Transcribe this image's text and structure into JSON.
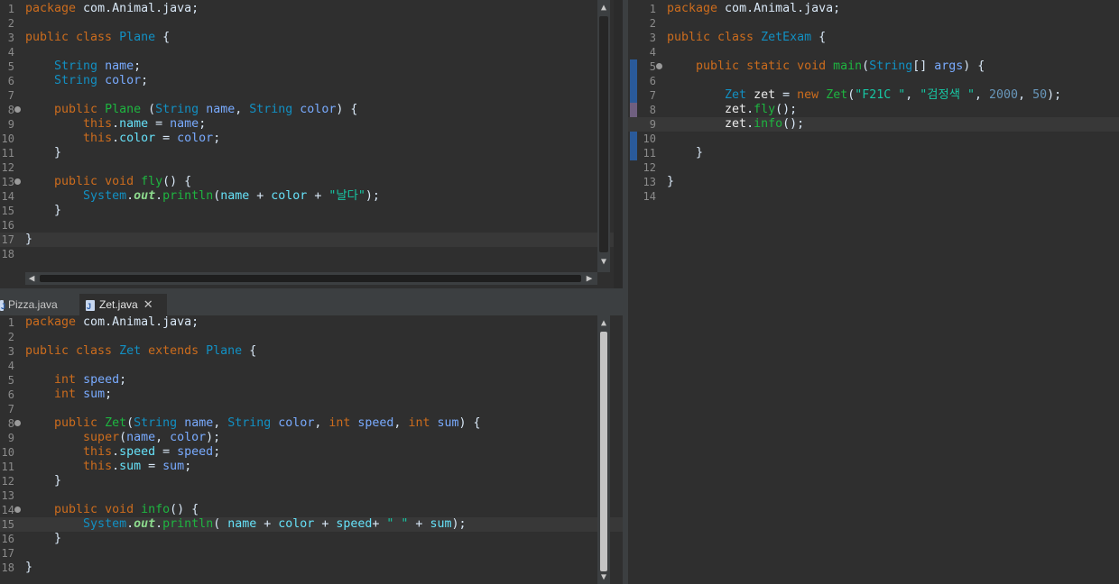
{
  "editors": {
    "plane": {
      "current_line": 17,
      "lines": [
        {
          "n": "1",
          "tokens": [
            [
              "kw",
              "package"
            ],
            [
              "plain",
              " com.Animal.java;"
            ]
          ]
        },
        {
          "n": "2",
          "tokens": []
        },
        {
          "n": "3",
          "tokens": [
            [
              "kw",
              "public class "
            ],
            [
              "type",
              "Plane "
            ],
            [
              "plain",
              "{"
            ]
          ]
        },
        {
          "n": "4",
          "tokens": []
        },
        {
          "n": "5",
          "tokens": [
            [
              "plain",
              "    "
            ],
            [
              "type",
              "String"
            ],
            [
              "plain",
              " "
            ],
            [
              "var",
              "name"
            ],
            [
              "plain",
              ";"
            ]
          ]
        },
        {
          "n": "6",
          "tokens": [
            [
              "plain",
              "    "
            ],
            [
              "type",
              "String"
            ],
            [
              "plain",
              " "
            ],
            [
              "var",
              "color"
            ],
            [
              "plain",
              ";"
            ]
          ]
        },
        {
          "n": "7",
          "tokens": []
        },
        {
          "n": "8",
          "fold": true,
          "tokens": [
            [
              "plain",
              "    "
            ],
            [
              "kw",
              "public "
            ],
            [
              "fn",
              "Plane"
            ],
            [
              "plain",
              " ("
            ],
            [
              "type",
              "String"
            ],
            [
              "plain",
              " "
            ],
            [
              "var",
              "name"
            ],
            [
              "plain",
              ", "
            ],
            [
              "type",
              "String"
            ],
            [
              "plain",
              " "
            ],
            [
              "var",
              "color"
            ],
            [
              "plain",
              ") {"
            ]
          ]
        },
        {
          "n": "9",
          "tokens": [
            [
              "plain",
              "        "
            ],
            [
              "kw",
              "this"
            ],
            [
              "plain",
              "."
            ],
            [
              "field",
              "name"
            ],
            [
              "plain",
              " = "
            ],
            [
              "var",
              "name"
            ],
            [
              "plain",
              ";"
            ]
          ]
        },
        {
          "n": "10",
          "tokens": [
            [
              "plain",
              "        "
            ],
            [
              "kw",
              "this"
            ],
            [
              "plain",
              "."
            ],
            [
              "field",
              "color"
            ],
            [
              "plain",
              " = "
            ],
            [
              "var",
              "color"
            ],
            [
              "plain",
              ";"
            ]
          ]
        },
        {
          "n": "11",
          "tokens": [
            [
              "plain",
              "    }"
            ]
          ]
        },
        {
          "n": "12",
          "tokens": []
        },
        {
          "n": "13",
          "fold": true,
          "tokens": [
            [
              "plain",
              "    "
            ],
            [
              "kw",
              "public void "
            ],
            [
              "fn",
              "fly"
            ],
            [
              "plain",
              "() {"
            ]
          ]
        },
        {
          "n": "14",
          "tokens": [
            [
              "plain",
              "        "
            ],
            [
              "type",
              "System"
            ],
            [
              "plain",
              "."
            ],
            [
              "static",
              "out"
            ],
            [
              "plain",
              "."
            ],
            [
              "fn",
              "println"
            ],
            [
              "plain",
              "("
            ],
            [
              "field",
              "name"
            ],
            [
              "plain",
              " + "
            ],
            [
              "field",
              "color"
            ],
            [
              "plain",
              " + "
            ],
            [
              "str",
              "\"날다\""
            ],
            [
              "plain",
              ");"
            ]
          ]
        },
        {
          "n": "15",
          "tokens": [
            [
              "plain",
              "    }"
            ]
          ]
        },
        {
          "n": "16",
          "tokens": []
        },
        {
          "n": "17",
          "tokens": [
            [
              "plain",
              "}"
            ]
          ]
        },
        {
          "n": "18",
          "tokens": []
        }
      ]
    },
    "zet": {
      "current_line": 15,
      "lines": [
        {
          "n": "1",
          "tokens": [
            [
              "kw",
              "package"
            ],
            [
              "plain",
              " com.Animal.java;"
            ]
          ]
        },
        {
          "n": "2",
          "tokens": []
        },
        {
          "n": "3",
          "tokens": [
            [
              "kw",
              "public class "
            ],
            [
              "type",
              "Zet "
            ],
            [
              "kw",
              "extends "
            ],
            [
              "type",
              "Plane"
            ],
            [
              "plain",
              " {"
            ]
          ]
        },
        {
          "n": "4",
          "tokens": []
        },
        {
          "n": "5",
          "tokens": [
            [
              "plain",
              "    "
            ],
            [
              "kw",
              "int"
            ],
            [
              "plain",
              " "
            ],
            [
              "var",
              "speed"
            ],
            [
              "plain",
              ";"
            ]
          ]
        },
        {
          "n": "6",
          "tokens": [
            [
              "plain",
              "    "
            ],
            [
              "kw",
              "int"
            ],
            [
              "plain",
              " "
            ],
            [
              "var",
              "sum"
            ],
            [
              "plain",
              ";"
            ]
          ]
        },
        {
          "n": "7",
          "tokens": []
        },
        {
          "n": "8",
          "fold": true,
          "tokens": [
            [
              "plain",
              "    "
            ],
            [
              "kw",
              "public "
            ],
            [
              "fn",
              "Zet"
            ],
            [
              "plain",
              "("
            ],
            [
              "type",
              "String"
            ],
            [
              "plain",
              " "
            ],
            [
              "var",
              "name"
            ],
            [
              "plain",
              ", "
            ],
            [
              "type",
              "String"
            ],
            [
              "plain",
              " "
            ],
            [
              "var",
              "color"
            ],
            [
              "plain",
              ", "
            ],
            [
              "kw",
              "int"
            ],
            [
              "plain",
              " "
            ],
            [
              "var",
              "speed"
            ],
            [
              "plain",
              ", "
            ],
            [
              "kw",
              "int"
            ],
            [
              "plain",
              " "
            ],
            [
              "var",
              "sum"
            ],
            [
              "plain",
              ") {"
            ]
          ]
        },
        {
          "n": "9",
          "tokens": [
            [
              "plain",
              "        "
            ],
            [
              "kw",
              "super"
            ],
            [
              "plain",
              "("
            ],
            [
              "var",
              "name"
            ],
            [
              "plain",
              ", "
            ],
            [
              "var",
              "color"
            ],
            [
              "plain",
              ");"
            ]
          ]
        },
        {
          "n": "10",
          "tokens": [
            [
              "plain",
              "        "
            ],
            [
              "kw",
              "this"
            ],
            [
              "plain",
              "."
            ],
            [
              "field",
              "speed"
            ],
            [
              "plain",
              " = "
            ],
            [
              "var",
              "speed"
            ],
            [
              "plain",
              ";"
            ]
          ]
        },
        {
          "n": "11",
          "tokens": [
            [
              "plain",
              "        "
            ],
            [
              "kw",
              "this"
            ],
            [
              "plain",
              "."
            ],
            [
              "field",
              "sum"
            ],
            [
              "plain",
              " = "
            ],
            [
              "var",
              "sum"
            ],
            [
              "plain",
              ";"
            ]
          ]
        },
        {
          "n": "12",
          "tokens": [
            [
              "plain",
              "    }"
            ]
          ]
        },
        {
          "n": "13",
          "tokens": []
        },
        {
          "n": "14",
          "fold": true,
          "tokens": [
            [
              "plain",
              "    "
            ],
            [
              "kw",
              "public void "
            ],
            [
              "fn",
              "info"
            ],
            [
              "plain",
              "() {"
            ]
          ]
        },
        {
          "n": "15",
          "tokens": [
            [
              "plain",
              "        "
            ],
            [
              "type",
              "System"
            ],
            [
              "plain",
              "."
            ],
            [
              "static",
              "out"
            ],
            [
              "plain",
              "."
            ],
            [
              "fn",
              "println"
            ],
            [
              "plain",
              "( "
            ],
            [
              "field",
              "name"
            ],
            [
              "plain",
              " + "
            ],
            [
              "field",
              "color"
            ],
            [
              "plain",
              " + "
            ],
            [
              "field",
              "speed"
            ],
            [
              "plain",
              "+ "
            ],
            [
              "str",
              "\" \""
            ],
            [
              "plain",
              " + "
            ],
            [
              "field",
              "sum"
            ],
            [
              "plain",
              ");"
            ]
          ]
        },
        {
          "n": "16",
          "tokens": [
            [
              "plain",
              "    }"
            ]
          ]
        },
        {
          "n": "17",
          "tokens": []
        },
        {
          "n": "18",
          "tokens": [
            [
              "plain",
              "}"
            ]
          ]
        }
      ]
    },
    "zetexam": {
      "current_line": 9,
      "lines": [
        {
          "n": "1",
          "tokens": [
            [
              "kw",
              "package"
            ],
            [
              "plain",
              " com.Animal.java;"
            ]
          ]
        },
        {
          "n": "2",
          "tokens": []
        },
        {
          "n": "3",
          "tokens": [
            [
              "kw",
              "public class "
            ],
            [
              "type",
              "ZetExam"
            ],
            [
              "plain",
              " {"
            ]
          ]
        },
        {
          "n": "4",
          "tokens": []
        },
        {
          "n": "5",
          "fold": true,
          "tokens": [
            [
              "plain",
              "    "
            ],
            [
              "kw",
              "public static void "
            ],
            [
              "fn",
              "main"
            ],
            [
              "plain",
              "("
            ],
            [
              "type",
              "String"
            ],
            [
              "plain",
              "[] "
            ],
            [
              "var",
              "args"
            ],
            [
              "plain",
              ") {"
            ]
          ]
        },
        {
          "n": "6",
          "tokens": []
        },
        {
          "n": "7",
          "tokens": [
            [
              "plain",
              "        "
            ],
            [
              "type",
              "Zet"
            ],
            [
              "plain",
              " "
            ],
            [
              "dim",
              "zet"
            ],
            [
              "plain",
              " = "
            ],
            [
              "kw",
              "new "
            ],
            [
              "fn",
              "Zet"
            ],
            [
              "plain",
              "("
            ],
            [
              "str",
              "\"F21C \""
            ],
            [
              "plain",
              ", "
            ],
            [
              "str",
              "\"검정색 \""
            ],
            [
              "plain",
              ", "
            ],
            [
              "num",
              "2000"
            ],
            [
              "plain",
              ", "
            ],
            [
              "num",
              "50"
            ],
            [
              "plain",
              ");"
            ]
          ]
        },
        {
          "n": "8",
          "tokens": [
            [
              "plain",
              "        "
            ],
            [
              "dim",
              "zet"
            ],
            [
              "plain",
              "."
            ],
            [
              "fn",
              "fly"
            ],
            [
              "plain",
              "();"
            ]
          ]
        },
        {
          "n": "9",
          "tokens": [
            [
              "plain",
              "        "
            ],
            [
              "dim",
              "zet"
            ],
            [
              "plain",
              "."
            ],
            [
              "fn",
              "info"
            ],
            [
              "plain",
              "();"
            ]
          ]
        },
        {
          "n": "10",
          "tokens": []
        },
        {
          "n": "11",
          "tokens": [
            [
              "plain",
              "    }"
            ]
          ]
        },
        {
          "n": "12",
          "tokens": []
        },
        {
          "n": "13",
          "tokens": [
            [
              "plain",
              "}"
            ]
          ]
        },
        {
          "n": "14",
          "tokens": []
        }
      ]
    }
  },
  "tabs": [
    {
      "label": "Pizza.java",
      "active": false
    },
    {
      "label": "Zet.java",
      "active": true
    }
  ],
  "icons": {
    "up": "▲",
    "down": "▼",
    "left": "◀",
    "right": "▶",
    "close": "✕"
  }
}
